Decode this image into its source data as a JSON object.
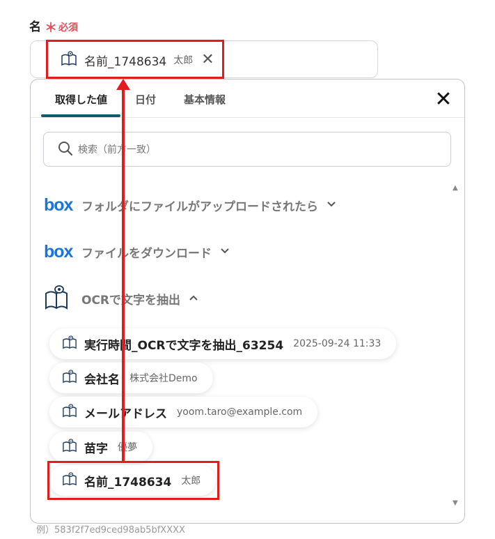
{
  "field": {
    "label": "名",
    "required_mark": "＊",
    "required_text": "必須",
    "chip": {
      "name": "名前_1748634",
      "value": "太郎",
      "remove_icon": "close-icon"
    },
    "hint": "例）583f2f7ed9ced98ab5bfXXXX"
  },
  "popup": {
    "tabs": [
      {
        "label": "取得した値",
        "active": true
      },
      {
        "label": "日付",
        "active": false
      },
      {
        "label": "基本情報",
        "active": false
      }
    ],
    "close_icon": "close-icon",
    "search": {
      "placeholder": "検索（前方一致）",
      "icon": "search-icon"
    },
    "groups": [
      {
        "logo": "box",
        "title": "フォルダにファイルがアップロードされたら",
        "chevron": "⌄",
        "expanded": false
      },
      {
        "logo": "box",
        "title": "ファイルをダウンロード",
        "chevron": "⌄",
        "expanded": false
      },
      {
        "icon": "book-eye-icon",
        "title": "OCRで文字を抽出",
        "chevron": "⌃",
        "expanded": true
      }
    ],
    "items": [
      {
        "name": "実行時間_OCRで文字を抽出_63254",
        "value": "2025-09-24 11:33"
      },
      {
        "name": "会社名",
        "value": "株式会社Demo"
      },
      {
        "name": "メールアドレス",
        "value": "yoom.taro@example.com"
      },
      {
        "name": "苗字",
        "value": "優夢"
      },
      {
        "name": "名前_1748634",
        "value": "太郎"
      }
    ],
    "scroll_up": "▲",
    "scroll_down": "▼"
  },
  "colors": {
    "accent_tab": "#0f5b6b",
    "required": "#e0515e",
    "box_brand": "#1b74d9",
    "annotation_red": "#e01e1e"
  }
}
